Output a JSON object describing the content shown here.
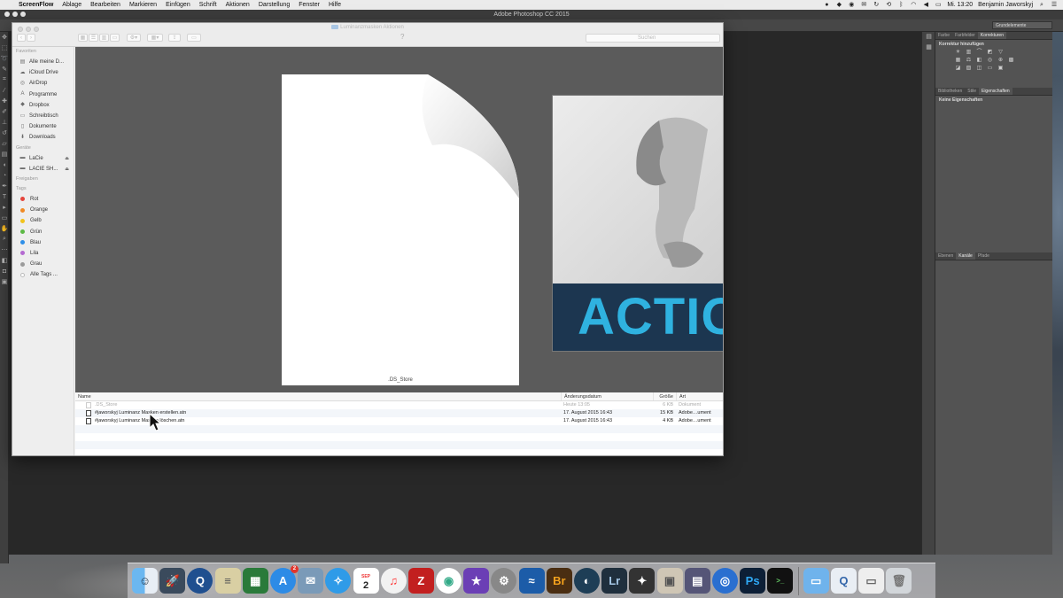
{
  "menubar": {
    "app_name": "ScreenFlow",
    "items": [
      "Ablage",
      "Bearbeiten",
      "Markieren",
      "Einfügen",
      "Schrift",
      "Aktionen",
      "Darstellung",
      "Fenster",
      "Hilfe"
    ],
    "clock": "Mi. 13:20",
    "user": "Benjamin Jaworskyj"
  },
  "photoshop": {
    "window_title": "Adobe Photoshop CC 2015",
    "workspace": "Grundelemente",
    "panels": {
      "top_tabs": [
        "Farbe",
        "Farbfelder",
        "Korrekturen"
      ],
      "adjustments_heading": "Korrektur hinzufügen",
      "mid_tabs": [
        "Bibliotheken",
        "Stile",
        "Eigenschaften"
      ],
      "properties_text": "Keine Eigenschaften",
      "bottom_tabs": [
        "Ebenen",
        "Kanäle",
        "Pfade"
      ]
    }
  },
  "finder": {
    "title": "Luminanzmasken Aktionen",
    "search_placeholder": "Suchen",
    "help_glyph": "?",
    "sidebar": {
      "favorites_label": "Favoriten",
      "favorites": [
        {
          "label": "Alle meine D...",
          "icon": "all-files-icon"
        },
        {
          "label": "iCloud Drive",
          "icon": "cloud-icon"
        },
        {
          "label": "AirDrop",
          "icon": "airdrop-icon"
        },
        {
          "label": "Programme",
          "icon": "applications-icon"
        },
        {
          "label": "Dropbox",
          "icon": "dropbox-icon"
        },
        {
          "label": "Schreibtisch",
          "icon": "desktop-icon"
        },
        {
          "label": "Dokumente",
          "icon": "documents-icon"
        },
        {
          "label": "Downloads",
          "icon": "downloads-icon"
        }
      ],
      "devices_label": "Geräte",
      "devices": [
        {
          "label": "LaCie"
        },
        {
          "label": "LACIE SH..."
        }
      ],
      "shared_label": "Freigaben",
      "tags_label": "Tags",
      "tags": [
        {
          "label": "Rot",
          "color": "#e5453c"
        },
        {
          "label": "Orange",
          "color": "#f08a24"
        },
        {
          "label": "Gelb",
          "color": "#f2c31b"
        },
        {
          "label": "Grün",
          "color": "#5cb944"
        },
        {
          "label": "Blau",
          "color": "#2e8fe8"
        },
        {
          "label": "Lila",
          "color": "#b46ad1"
        },
        {
          "label": "Grau",
          "color": "#9b9b9b"
        },
        {
          "label": "Alle Tags ...",
          "color": "#ffffff"
        }
      ]
    },
    "preview": {
      "doc_caption": ".DS_Store",
      "action_text": "ACTIOI"
    },
    "list": {
      "columns": {
        "name": "Name",
        "date": "Änderungsdatum",
        "size": "Größe",
        "kind": "Art"
      },
      "rows": [
        {
          "name": ".DS_Store",
          "date": "Heute 13:05",
          "size": "6 KB",
          "kind": "Dokument"
        },
        {
          "name": "#jaworskyj Luminanz Masken erstellen.atn",
          "date": "17. August 2015 16:43",
          "size": "15 KB",
          "kind": "Adobe…ument"
        },
        {
          "name": "#jaworskyj Luminanz Masken löschen.atn",
          "date": "17. August 2015 16:43",
          "size": "4 KB",
          "kind": "Adobe…ument"
        }
      ]
    }
  },
  "dock": {
    "calendar_month": "SEP",
    "calendar_day": "2",
    "appstore_badge": "2",
    "apps": [
      "Br",
      "Lr",
      "Ps"
    ]
  }
}
